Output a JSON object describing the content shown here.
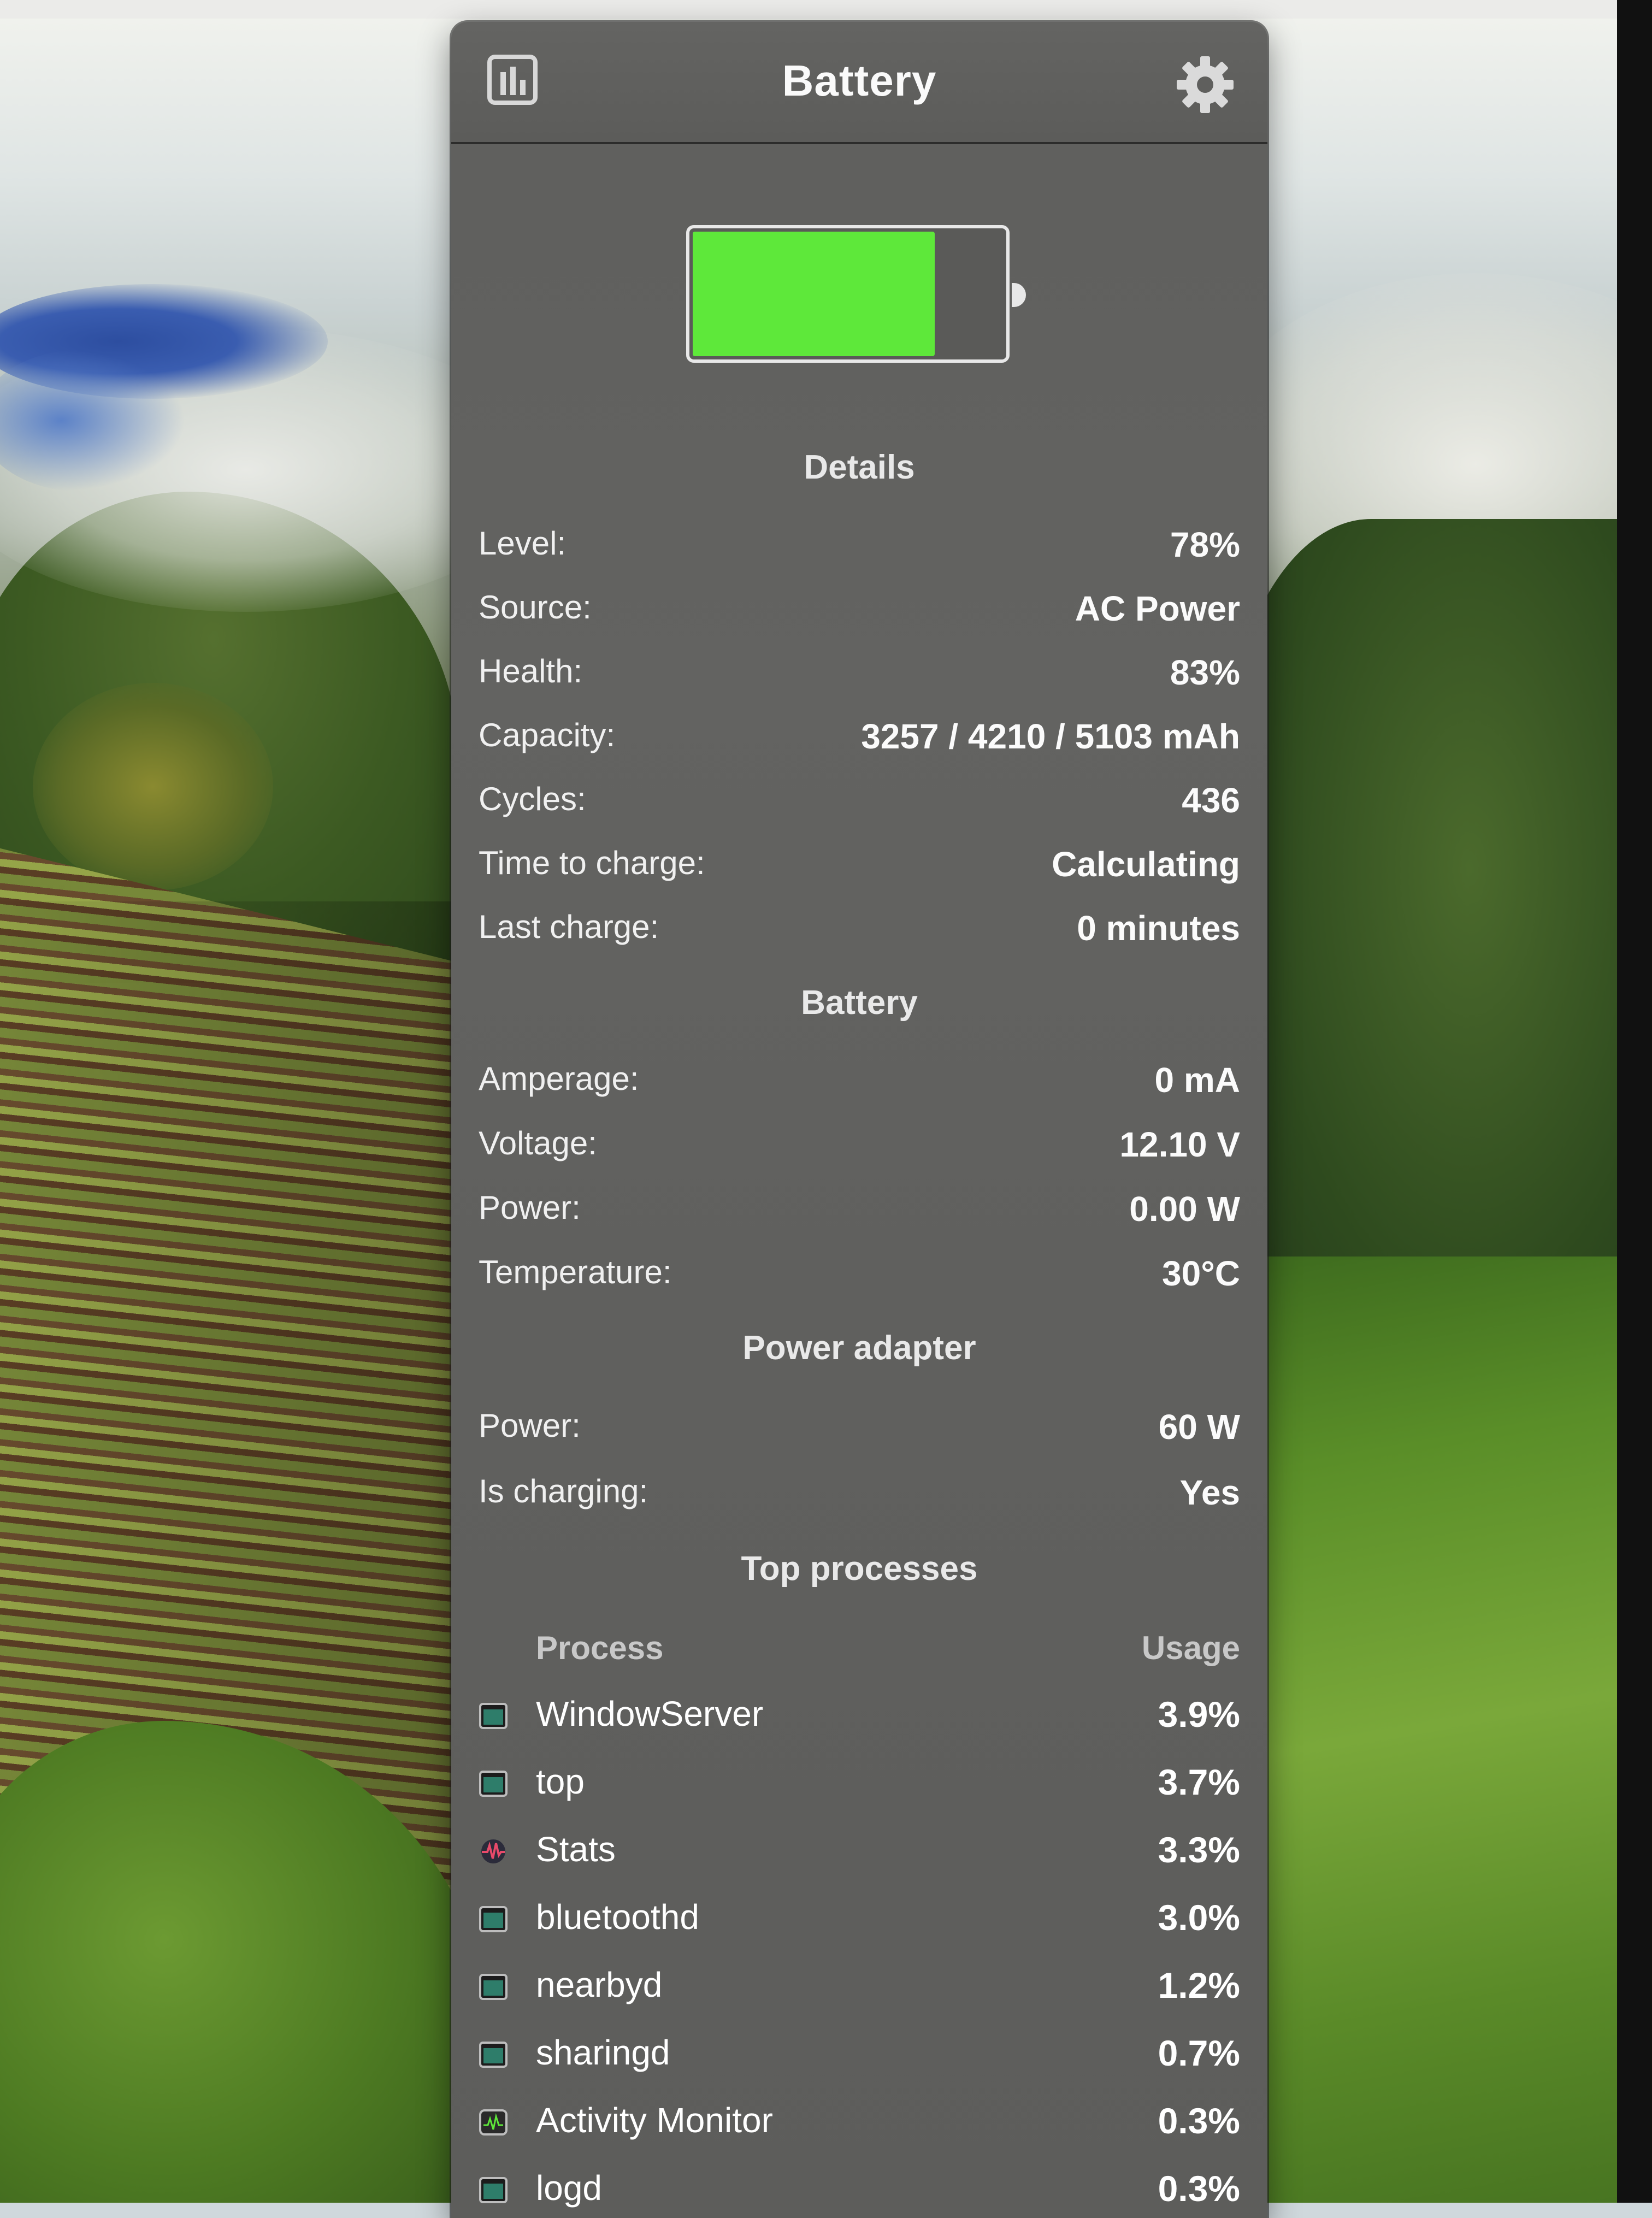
{
  "popup": {
    "title": "Battery",
    "header_left_icon": "chart-icon",
    "header_right_icon": "gear-icon"
  },
  "battery_graphic": {
    "level_fraction": 0.78,
    "fill_color": "#5ee83a"
  },
  "details": {
    "title": "Details",
    "rows": [
      {
        "label": "Level:",
        "value": "78%"
      },
      {
        "label": "Source:",
        "value": "AC Power"
      },
      {
        "label": "Health:",
        "value": "83%"
      },
      {
        "label": "Capacity:",
        "value": "3257 / 4210 / 5103 mAh"
      },
      {
        "label": "Cycles:",
        "value": "436"
      },
      {
        "label": "Time to charge:",
        "value": "Calculating"
      },
      {
        "label": "Last charge:",
        "value": "0 minutes"
      }
    ]
  },
  "battery": {
    "title": "Battery",
    "rows": [
      {
        "label": "Amperage:",
        "value": "0 mA"
      },
      {
        "label": "Voltage:",
        "value": "12.10 V"
      },
      {
        "label": "Power:",
        "value": "0.00 W"
      },
      {
        "label": "Temperature:",
        "value": "30°C"
      }
    ]
  },
  "power_adapter": {
    "title": "Power adapter",
    "rows": [
      {
        "label": "Power:",
        "value": "60 W"
      },
      {
        "label": "Is charging:",
        "value": "Yes"
      }
    ]
  },
  "top_processes": {
    "title": "Top processes",
    "col_process": "Process",
    "col_usage": "Usage",
    "items": [
      {
        "name": "WindowServer",
        "usage": "3.9%",
        "icon": "terminal-app-icon"
      },
      {
        "name": "top",
        "usage": "3.7%",
        "icon": "terminal-app-icon"
      },
      {
        "name": "Stats",
        "usage": "3.3%",
        "icon": "stats-app-icon"
      },
      {
        "name": "bluetoothd",
        "usage": "3.0%",
        "icon": "terminal-app-icon"
      },
      {
        "name": "nearbyd",
        "usage": "1.2%",
        "icon": "terminal-app-icon"
      },
      {
        "name": "sharingd",
        "usage": "0.7%",
        "icon": "terminal-app-icon"
      },
      {
        "name": "Activity Monitor",
        "usage": "0.3%",
        "icon": "activity-monitor-icon"
      },
      {
        "name": "logd",
        "usage": "0.3%",
        "icon": "terminal-app-icon"
      }
    ]
  }
}
